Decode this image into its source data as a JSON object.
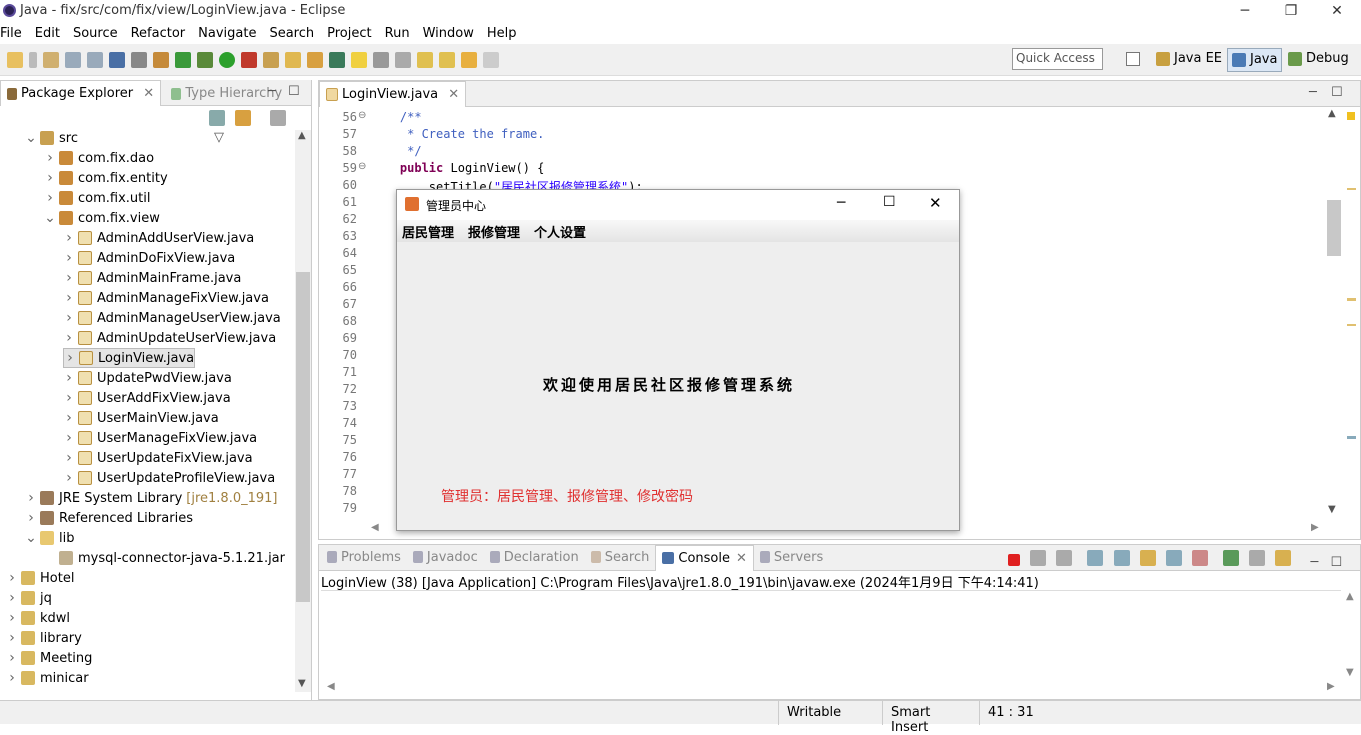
{
  "window": {
    "title": "Java - fix/src/com/fix/view/LoginView.java - Eclipse",
    "min_glyph": "─",
    "max_glyph": "❐",
    "close_glyph": "✕"
  },
  "menu": [
    "File",
    "Edit",
    "Source",
    "Refactor",
    "Navigate",
    "Search",
    "Project",
    "Run",
    "Window",
    "Help"
  ],
  "toolbar": {
    "quick_access_placeholder": "Quick Access"
  },
  "perspectives": [
    "Java EE",
    "Java",
    "Debug"
  ],
  "left_panel": {
    "tabs": [
      {
        "label": "Package Explorer",
        "active": true
      },
      {
        "label": "Type Hierarchy",
        "active": false
      }
    ],
    "tree": [
      {
        "label": "src",
        "indent": 1,
        "twisty": "open",
        "icon": "source-folder-icon"
      },
      {
        "label": "com.fix.dao",
        "indent": 2,
        "twisty": "closed",
        "icon": "package-icon"
      },
      {
        "label": "com.fix.entity",
        "indent": 2,
        "twisty": "closed",
        "icon": "package-icon"
      },
      {
        "label": "com.fix.util",
        "indent": 2,
        "twisty": "closed",
        "icon": "package-icon"
      },
      {
        "label": "com.fix.view",
        "indent": 2,
        "twisty": "open",
        "icon": "package-icon"
      },
      {
        "label": "AdminAddUserView.java",
        "indent": 3,
        "twisty": "closed",
        "icon": "java-file-icon"
      },
      {
        "label": "AdminDoFixView.java",
        "indent": 3,
        "twisty": "closed",
        "icon": "java-file-icon"
      },
      {
        "label": "AdminMainFrame.java",
        "indent": 3,
        "twisty": "closed",
        "icon": "java-file-icon"
      },
      {
        "label": "AdminManageFixView.java",
        "indent": 3,
        "twisty": "closed",
        "icon": "java-file-icon"
      },
      {
        "label": "AdminManageUserView.java",
        "indent": 3,
        "twisty": "closed",
        "icon": "java-file-icon"
      },
      {
        "label": "AdminUpdateUserView.java",
        "indent": 3,
        "twisty": "closed",
        "icon": "java-file-icon"
      },
      {
        "label": "LoginView.java",
        "indent": 3,
        "twisty": "closed",
        "icon": "java-file-icon",
        "selected": true
      },
      {
        "label": "UpdatePwdView.java",
        "indent": 3,
        "twisty": "closed",
        "icon": "java-file-icon"
      },
      {
        "label": "UserAddFixView.java",
        "indent": 3,
        "twisty": "closed",
        "icon": "java-file-icon"
      },
      {
        "label": "UserMainView.java",
        "indent": 3,
        "twisty": "closed",
        "icon": "java-file-icon"
      },
      {
        "label": "UserManageFixView.java",
        "indent": 3,
        "twisty": "closed",
        "icon": "java-file-icon"
      },
      {
        "label": "UserUpdateFixView.java",
        "indent": 3,
        "twisty": "closed",
        "icon": "java-file-icon"
      },
      {
        "label": "UserUpdateProfileView.java",
        "indent": 3,
        "twisty": "closed",
        "icon": "java-file-icon"
      },
      {
        "label": "JRE System Library",
        "suffix": "[jre1.8.0_191]",
        "indent": 1,
        "twisty": "closed",
        "icon": "library-icon"
      },
      {
        "label": "Referenced Libraries",
        "indent": 1,
        "twisty": "closed",
        "icon": "library-icon"
      },
      {
        "label": "lib",
        "indent": 1,
        "twisty": "open",
        "icon": "folder-icon"
      },
      {
        "label": "mysql-connector-java-5.1.21.jar",
        "indent": 2,
        "twisty": "none",
        "icon": "jar-icon"
      },
      {
        "label": "Hotel",
        "indent": 0,
        "twisty": "closed",
        "icon": "project-icon"
      },
      {
        "label": "jq",
        "indent": 0,
        "twisty": "closed",
        "icon": "project-icon"
      },
      {
        "label": "kdwl",
        "indent": 0,
        "twisty": "closed",
        "icon": "project-icon"
      },
      {
        "label": "library",
        "indent": 0,
        "twisty": "closed",
        "icon": "project-icon"
      },
      {
        "label": "Meeting",
        "indent": 0,
        "twisty": "closed",
        "icon": "project-icon"
      },
      {
        "label": "minicar",
        "indent": 0,
        "twisty": "closed",
        "icon": "project-icon"
      }
    ]
  },
  "editor": {
    "tab_label": "LoginView.java",
    "lines": [
      {
        "n": "56",
        "text": "    /**",
        "kind": "comment",
        "fold": true
      },
      {
        "n": "57",
        "text": "     * Create the frame.",
        "kind": "comment"
      },
      {
        "n": "58",
        "text": "     */",
        "kind": "comment"
      },
      {
        "n": "59",
        "text": "    public LoginView() {",
        "kind": "code",
        "fold": true
      },
      {
        "n": "60",
        "text": "        setTitle(\"居民社区报修管理系统\");",
        "kind": "code"
      },
      {
        "n": "61",
        "text": "",
        "kind": "code"
      },
      {
        "n": "62",
        "text": "",
        "kind": "code"
      },
      {
        "n": "63",
        "text": "",
        "kind": "code"
      },
      {
        "n": "64",
        "text": "",
        "kind": "code"
      },
      {
        "n": "65",
        "text": "",
        "kind": "code"
      },
      {
        "n": "66",
        "text": "",
        "kind": "code"
      },
      {
        "n": "67",
        "text": "",
        "kind": "code"
      },
      {
        "n": "68",
        "text": "",
        "kind": "code"
      },
      {
        "n": "69",
        "text": "",
        "kind": "code"
      },
      {
        "n": "70",
        "text": "",
        "kind": "code"
      },
      {
        "n": "71",
        "text": "",
        "kind": "code"
      },
      {
        "n": "72",
        "text": "",
        "kind": "code"
      },
      {
        "n": "73",
        "text": "",
        "kind": "code"
      },
      {
        "n": "74",
        "text": "",
        "kind": "code"
      },
      {
        "n": "75",
        "text": "",
        "kind": "code"
      },
      {
        "n": "76",
        "text": "",
        "kind": "code"
      },
      {
        "n": "77",
        "text": "",
        "kind": "code"
      },
      {
        "n": "78",
        "text": "",
        "kind": "code"
      },
      {
        "n": "79",
        "text": "",
        "kind": "code"
      }
    ]
  },
  "dialog": {
    "title": "管理员中心",
    "menu": [
      "居民管理",
      "报修管理",
      "个人设置"
    ],
    "welcome": "欢迎使用居民社区报修管理系统",
    "footer": "管理员：居民管理、报修管理、修改密码"
  },
  "bottom_panel": {
    "tabs": [
      {
        "label": "Problems",
        "active": false
      },
      {
        "label": "Javadoc",
        "active": false
      },
      {
        "label": "Declaration",
        "active": false
      },
      {
        "label": "Search",
        "active": false
      },
      {
        "label": "Console",
        "active": true
      },
      {
        "label": "Servers",
        "active": false
      }
    ],
    "console_header": "LoginView (38) [Java Application] C:\\Program Files\\Java\\jre1.8.0_191\\bin\\javaw.exe (2024年1月9日 下午4:14:41)"
  },
  "status": {
    "writable": "Writable",
    "insert_mode": "Smart Insert",
    "position": "41 : 31"
  },
  "colors": {
    "keyword": "#7f0055",
    "comment": "#3f5fbf",
    "string": "#2a00ff",
    "footer_red": "#e03030"
  }
}
